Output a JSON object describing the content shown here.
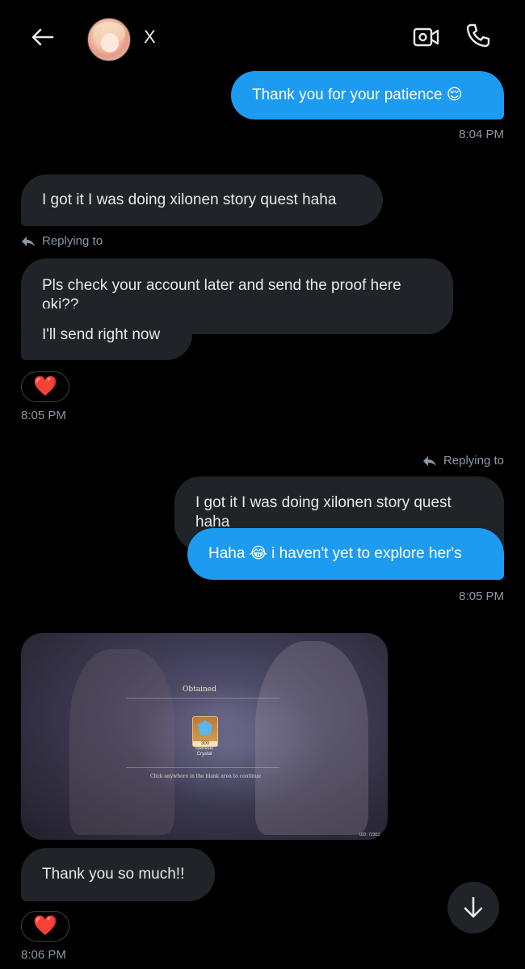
{
  "header": {
    "contact_name": "X",
    "icons": {
      "back": "arrow-left-icon",
      "video": "video-camera-icon",
      "call": "phone-icon"
    }
  },
  "colors": {
    "sent_bubble": "#1d9bf0",
    "received_bubble": "#202327",
    "background": "#000000",
    "timestamp": "#8b98a5"
  },
  "messages": {
    "m1": {
      "text": "Thank you for your patience 😌",
      "time": "8:04 PM"
    },
    "m2": {
      "text": "I got it I was doing xilonen story quest haha"
    },
    "m3": {
      "reply_label": "Replying to",
      "quoted": "Pls check your account later and send the proof here oki??",
      "text": "I'll send right now",
      "reaction": "❤️",
      "time": "8:05 PM"
    },
    "m4": {
      "reply_label": "Replying to",
      "quoted": "I got it I was doing xilonen story quest haha",
      "text": "Haha 😂 i haven't yet to explore her's",
      "time": "8:05 PM"
    },
    "m5": {
      "image": {
        "obtained": "Obtained",
        "item_count": "300",
        "item_name": "Genesis Crystal",
        "hint": "Click anywhere in the blank area to continue",
        "uid": "UID: 72303"
      },
      "text": "Thank you so much!!",
      "reaction": "❤️",
      "time": "8:06 PM"
    }
  },
  "scroll_button": {
    "icon": "arrow-down-icon"
  }
}
